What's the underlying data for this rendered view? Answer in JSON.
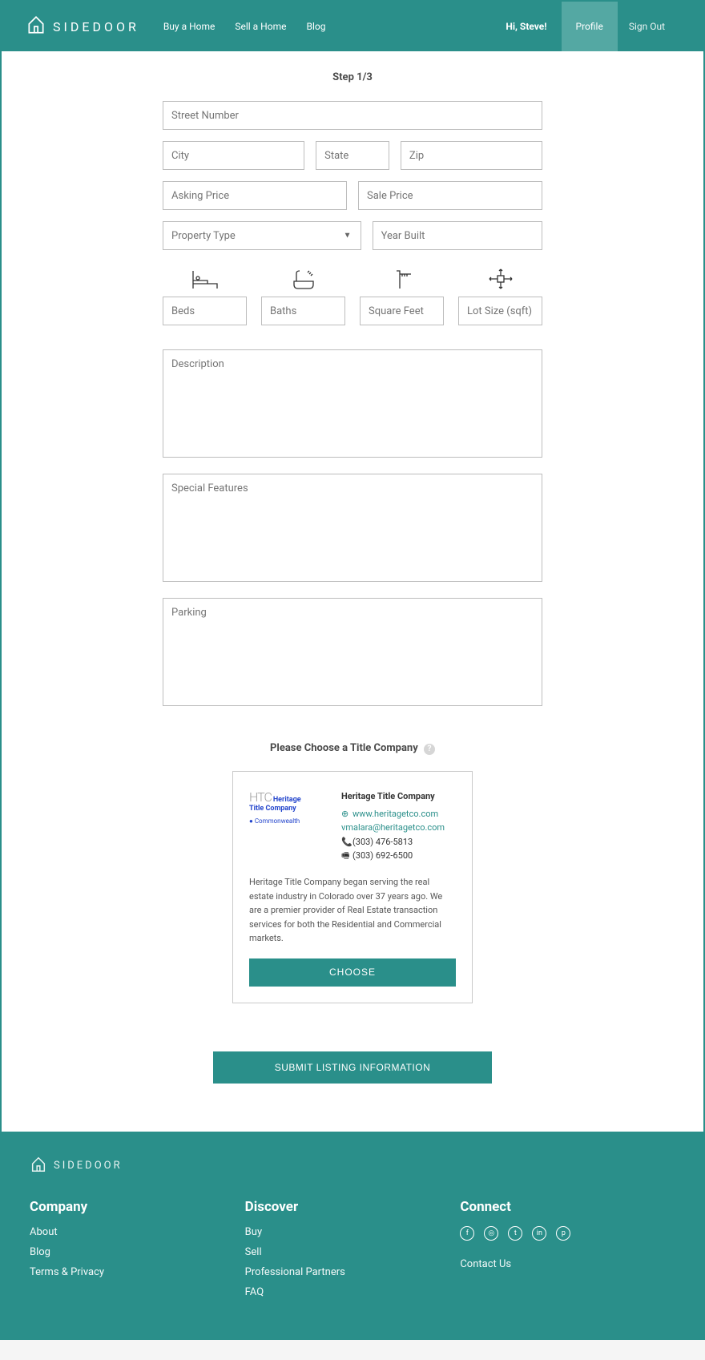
{
  "brand": "SIDEDOOR",
  "nav": {
    "buy": "Buy a Home",
    "sell": "Sell a Home",
    "blog": "Blog"
  },
  "rightNav": {
    "greeting": "Hi, Steve!",
    "profile": "Profile",
    "signOut": "Sign Out"
  },
  "step": "Step 1/3",
  "placeholders": {
    "street": "Street Number",
    "city": "City",
    "state": "State",
    "zip": "Zip",
    "askingPrice": "Asking Price",
    "salePrice": "Sale Price",
    "propertyType": "Property Type",
    "yearBuilt": "Year Built",
    "beds": "Beds",
    "baths": "Baths",
    "sqft": "Square Feet",
    "lot": "Lot Size (sqft)",
    "description": "Description",
    "features": "Special Features",
    "parking": "Parking"
  },
  "titleSection": {
    "heading": "Please Choose a Title Company",
    "card": {
      "name": "Heritage Title Company",
      "website": "www.heritagetco.com",
      "email": "vmalara@heritagetco.com",
      "phone": "(303) 476-5813",
      "fax": "(303) 692-6500",
      "desc": "Heritage Title Company began serving the real estate industry in Colorado over 37 years ago. We are a premier provider of Real Estate transaction services for both the Residential and Commercial markets.",
      "chooseBtn": "CHOOSE"
    }
  },
  "submitBtn": "SUBMIT LISTING INFORMATION",
  "footer": {
    "company": {
      "h": "Company",
      "about": "About",
      "blog": "Blog",
      "terms": "Terms & Privacy"
    },
    "discover": {
      "h": "Discover",
      "buy": "Buy",
      "sell": "Sell",
      "partners": "Professional Partners",
      "faq": "FAQ"
    },
    "connect": {
      "h": "Connect",
      "contact": "Contact Us"
    }
  }
}
